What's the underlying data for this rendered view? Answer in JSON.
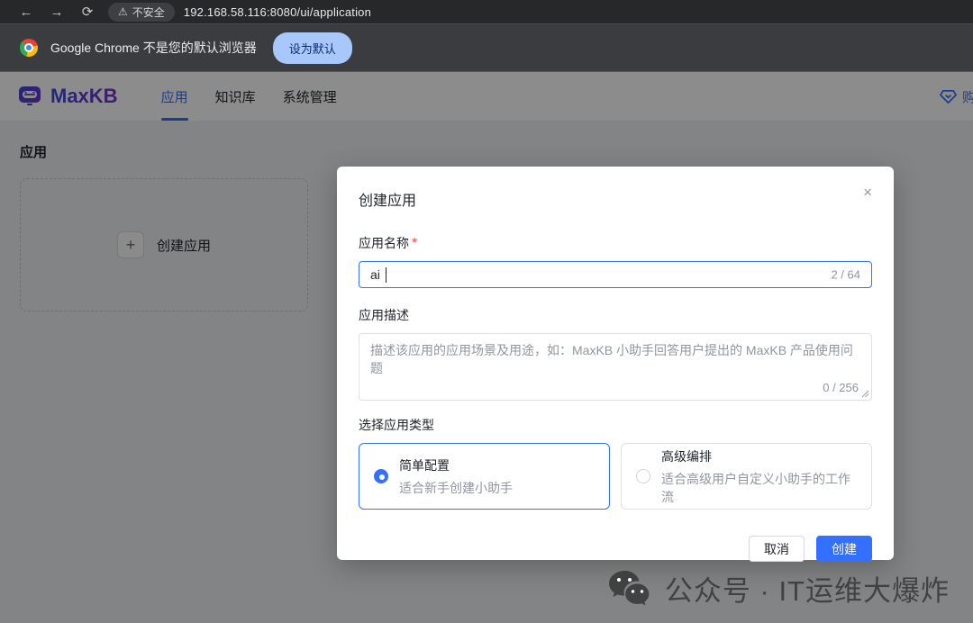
{
  "browser": {
    "back_glyph": "←",
    "forward_glyph": "→",
    "refresh_glyph": "⟳",
    "security_warning_glyph": "⚠",
    "security_badge": "不安全",
    "url": "192.168.58.116:8080/ui/application",
    "infobar": {
      "message": "Google Chrome 不是您的默认浏览器",
      "action_label": "设为默认"
    }
  },
  "header": {
    "brand": "MaxKB",
    "tabs": [
      {
        "label": "应用",
        "active": true
      },
      {
        "label": "知识库",
        "active": false
      },
      {
        "label": "系统管理",
        "active": false
      }
    ],
    "upgrade_label": "购"
  },
  "page": {
    "title": "应用",
    "create_card": {
      "plus_glyph": "+",
      "label": "创建应用"
    }
  },
  "modal": {
    "title": "创建应用",
    "close_glyph": "×",
    "fields": {
      "name": {
        "label": "应用名称",
        "required_mark": "*",
        "value": "ai",
        "counter": "2 / 64"
      },
      "description": {
        "label": "应用描述",
        "placeholder": "描述该应用的应用场景及用途，如：MaxKB 小助手回答用户提出的 MaxKB 产品使用问题",
        "counter": "0 / 256"
      }
    },
    "type_label": "选择应用类型",
    "type_options": [
      {
        "title": "简单配置",
        "subtitle": "适合新手创建小助手",
        "selected": true
      },
      {
        "title": "高级编排",
        "subtitle": "适合高级用户自定义小助手的工作流",
        "selected": false
      }
    ],
    "cancel_label": "取消",
    "confirm_label": "创建"
  },
  "watermark": {
    "text": "公众号 · IT运维大爆炸"
  },
  "colors": {
    "accent_blue": "#3370ff",
    "brand_purple": "#4f2ec9",
    "danger_red": "#f54a45",
    "counter_gray": "#8f959e",
    "infobar_button_bg": "#a8c7fa"
  }
}
